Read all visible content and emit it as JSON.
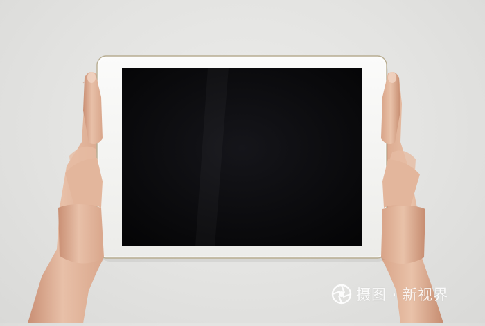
{
  "scene": {
    "subject": "tablet-held-by-hands",
    "background_color": "#e4e4e2",
    "tablet_frame_color": "#f6f6f4",
    "screen_color": "#0a0a0c",
    "skin_color": "#e2b79f"
  },
  "watermark": {
    "text": "摄图 · 新视界",
    "icon": "camera-aperture-logo-icon"
  }
}
